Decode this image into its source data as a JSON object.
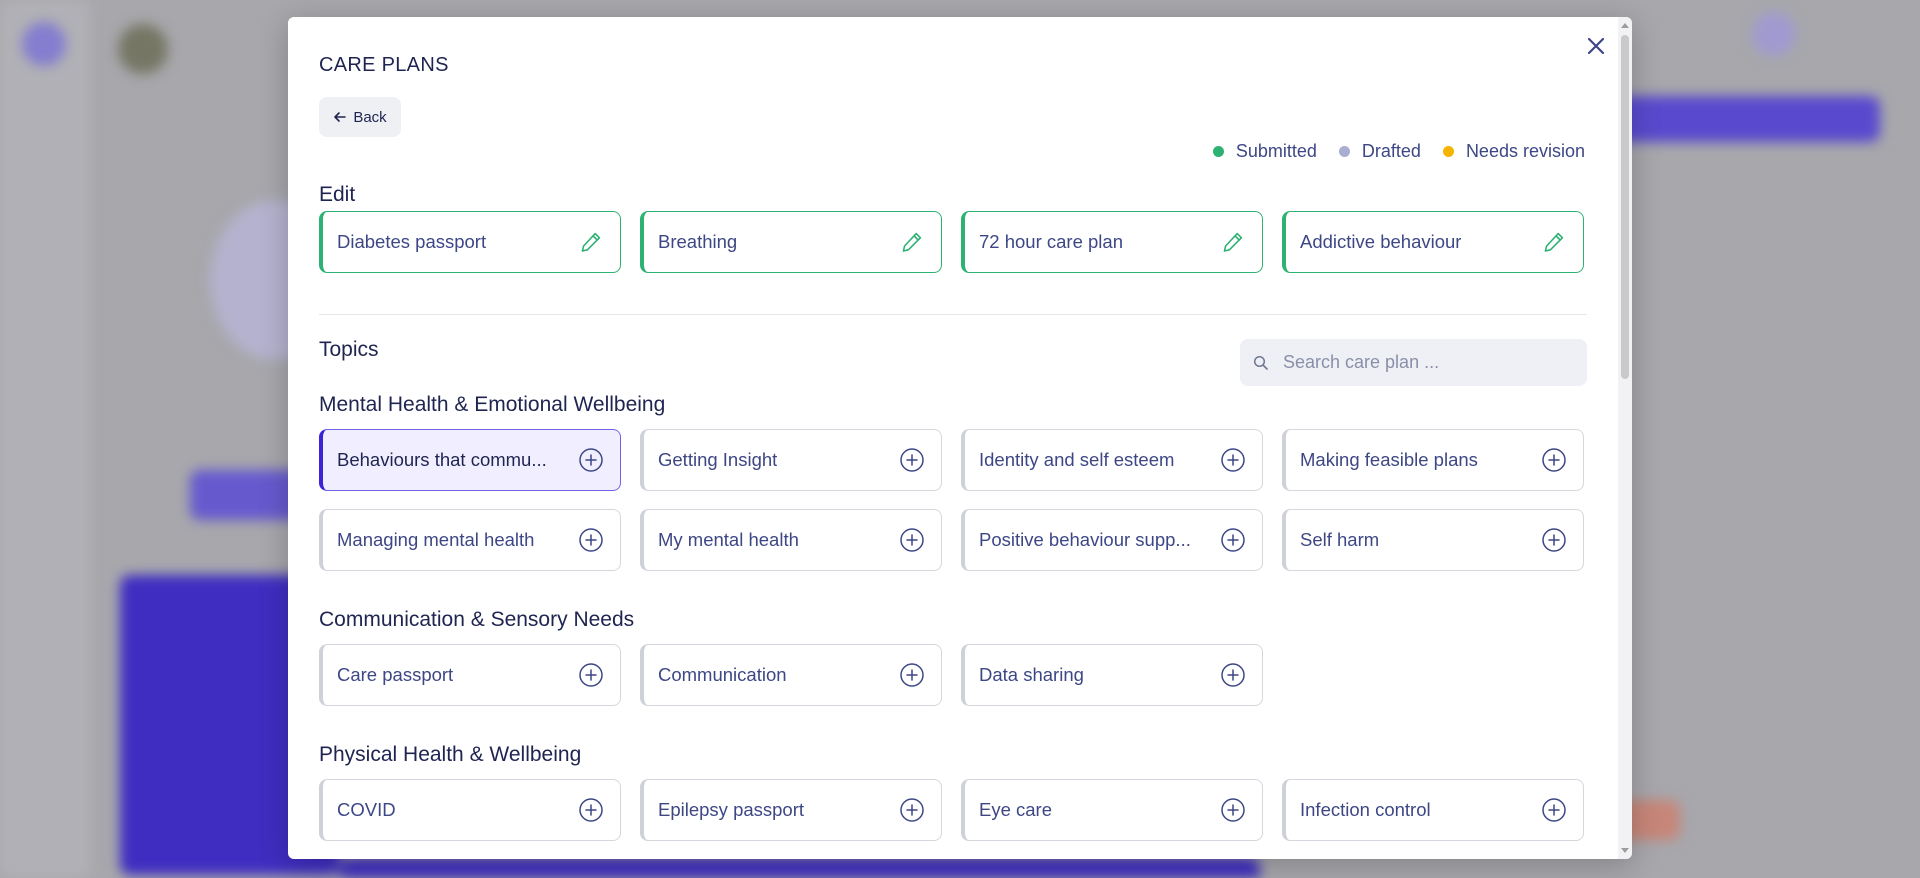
{
  "modal": {
    "title": "CARE PLANS",
    "back_label": "Back"
  },
  "legend": [
    {
      "label": "Submitted",
      "color": "#2eb274"
    },
    {
      "label": "Drafted",
      "color": "#a9add1"
    },
    {
      "label": "Needs revision",
      "color": "#f5b400"
    }
  ],
  "edit": {
    "label": "Edit",
    "items": [
      {
        "label": "Diabetes passport",
        "icon": "pencil-icon"
      },
      {
        "label": "Breathing",
        "icon": "pencil-icon"
      },
      {
        "label": "72 hour care plan",
        "icon": "pencil-icon"
      },
      {
        "label": "Addictive behaviour",
        "icon": "pencil-icon"
      }
    ]
  },
  "topics": {
    "label": "Topics",
    "search_placeholder": "Search care plan ...",
    "categories": [
      {
        "name": "Mental Health & Emotional Wellbeing",
        "items": [
          {
            "label": "Behaviours that commu...",
            "selected": true
          },
          {
            "label": "Getting Insight"
          },
          {
            "label": "Identity and self esteem"
          },
          {
            "label": "Making feasible plans"
          },
          {
            "label": "Managing mental health"
          },
          {
            "label": "My mental health"
          },
          {
            "label": "Positive behaviour supp..."
          },
          {
            "label": "Self harm"
          }
        ]
      },
      {
        "name": "Communication & Sensory Needs",
        "items": [
          {
            "label": "Care passport"
          },
          {
            "label": "Communication"
          },
          {
            "label": "Data sharing"
          }
        ]
      },
      {
        "name": "Physical Health & Wellbeing",
        "items": [
          {
            "label": "COVID"
          },
          {
            "label": "Epilepsy passport"
          },
          {
            "label": "Eye care"
          },
          {
            "label": "Infection control"
          }
        ]
      }
    ]
  },
  "colors": {
    "accent": "#3a24d6",
    "edit_border": "#2eb274",
    "text_primary": "#1f2450",
    "text_secondary": "#3d4785"
  }
}
